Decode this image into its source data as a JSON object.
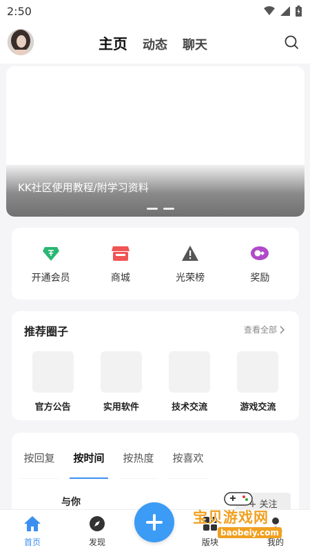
{
  "status_bar": {
    "time": "2:50"
  },
  "header": {
    "tabs": [
      "主页",
      "动态",
      "聊天"
    ]
  },
  "banner": {
    "caption": "KK社区使用教程/附学习资料"
  },
  "quick_actions": [
    {
      "label": "开通会员",
      "icon": "diamond-icon",
      "color": "#2bb673"
    },
    {
      "label": "商城",
      "icon": "store-icon",
      "color": "#f05454"
    },
    {
      "label": "光荣榜",
      "icon": "warning-icon",
      "color": "#555555"
    },
    {
      "label": "奖励",
      "icon": "reward-icon",
      "color": "#b04ac9"
    }
  ],
  "recommended": {
    "title": "推荐圈子",
    "more": "查看全部",
    "items": [
      "官方公告",
      "实用软件",
      "技术交流",
      "游戏交流"
    ]
  },
  "feed": {
    "sorts": [
      "按回复",
      "按时间",
      "按热度",
      "按喜欢"
    ],
    "active_sort": "按时间",
    "author": "与你",
    "follow_label": "+ 关注"
  },
  "bottom_nav": [
    {
      "label": "首页",
      "icon": "home-icon",
      "active": true
    },
    {
      "label": "发现",
      "icon": "compass-icon",
      "active": false
    },
    {
      "label": "版块",
      "icon": "grid-icon",
      "active": false
    },
    {
      "label": "我的",
      "icon": "user-icon",
      "active": false
    }
  ],
  "watermark": {
    "text": "宝贝游戏网",
    "url": "baobeiy.com"
  },
  "colors": {
    "accent": "#3b8ff0",
    "fab": "#3b9bf5"
  }
}
